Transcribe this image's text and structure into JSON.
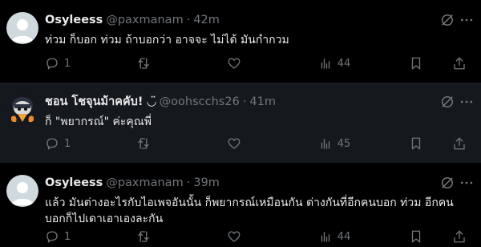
{
  "tweets": [
    {
      "name": "Osyleess",
      "handle": "@paxmanam",
      "time": "42m",
      "text": "ท่วม ก็บอก ท่วม ถ้าบอกว่า อาจจะ ไม่ได้ มันกำกวม",
      "replies": "1",
      "retweets": "",
      "likes": "",
      "views": "44",
      "avatar": "default-avatar"
    },
    {
      "name": "ชอน โชจุนม้าคคับ! ◡̈",
      "handle": "@oohscchs26",
      "time": "41m",
      "text": "ก็ \"พยากรณ์\" ค่ะคุณพี่",
      "replies": "1",
      "retweets": "",
      "likes": "",
      "views": "45",
      "avatar": "cartoon-avatar"
    },
    {
      "name": "Osyleess",
      "handle": "@paxmanam",
      "time": "39m",
      "text": "แล้ว มันต่างอะไรกับไอเพจอันนั้น ก็พยากรณ์เหมือนกัน ต่างกันที่อีกคนบอก ท่วม อีกคนบอกก็ไปเดาเอาเองละกัน",
      "replies": "1",
      "retweets": "",
      "likes": "",
      "views": "44",
      "avatar": "default-avatar"
    }
  ],
  "separator": "·",
  "colors": {
    "bg": "#000000",
    "highlight_bg": "#15181c",
    "muted": "#71767b",
    "text": "#e7e9ea"
  }
}
